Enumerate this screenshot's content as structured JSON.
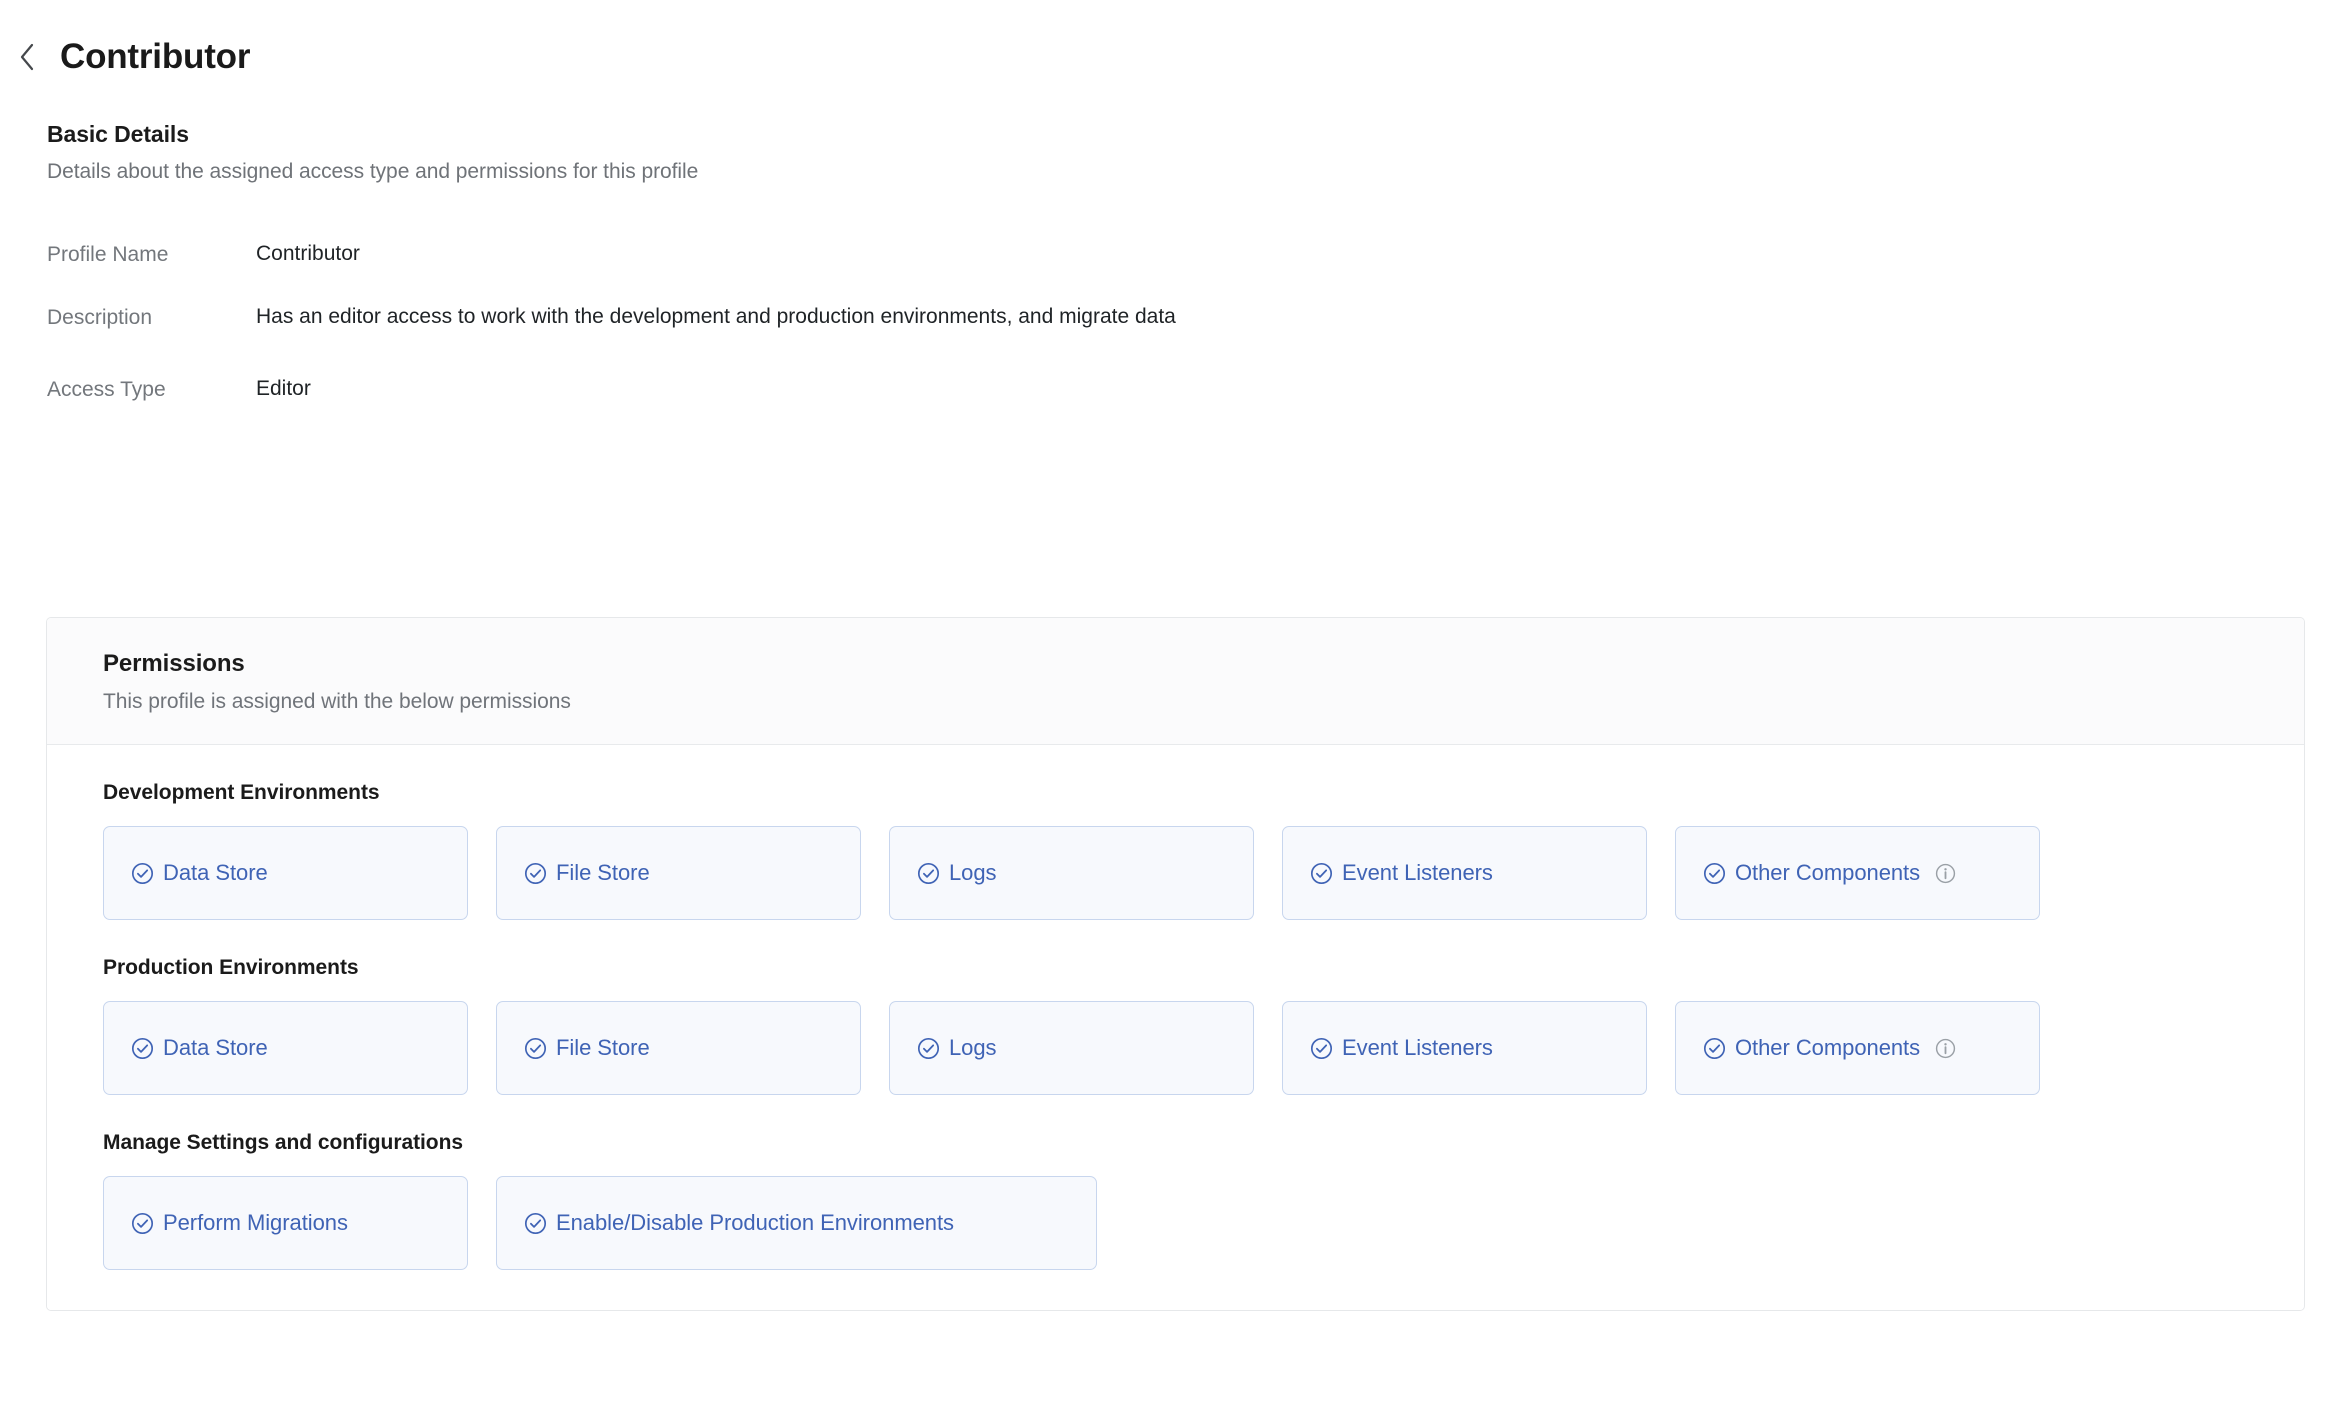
{
  "header": {
    "back_icon": "chevron-left-icon",
    "title": "Contributor"
  },
  "basic_details": {
    "title": "Basic Details",
    "subtitle": "Details about the assigned access type and permissions for this profile",
    "fields": [
      {
        "label": "Profile Name",
        "value": "Contributor"
      },
      {
        "label": "Description",
        "value": "Has an editor access to work with the development and production environments, and migrate data"
      },
      {
        "label": "Access Type",
        "value": "Editor"
      }
    ]
  },
  "permissions": {
    "title": "Permissions",
    "subtitle": "This profile is assigned with the below permissions",
    "groups": [
      {
        "title": "Development Environments",
        "chips": [
          {
            "label": "Data Store",
            "icon": "check-circle-icon",
            "info": false,
            "wide": false
          },
          {
            "label": "File Store",
            "icon": "check-circle-icon",
            "info": false,
            "wide": false
          },
          {
            "label": "Logs",
            "icon": "check-circle-icon",
            "info": false,
            "wide": false
          },
          {
            "label": "Event Listeners",
            "icon": "check-circle-icon",
            "info": false,
            "wide": false
          },
          {
            "label": "Other Components",
            "icon": "check-circle-icon",
            "info": true,
            "wide": false
          }
        ]
      },
      {
        "title": "Production Environments",
        "chips": [
          {
            "label": "Data Store",
            "icon": "check-circle-icon",
            "info": false,
            "wide": false
          },
          {
            "label": "File Store",
            "icon": "check-circle-icon",
            "info": false,
            "wide": false
          },
          {
            "label": "Logs",
            "icon": "check-circle-icon",
            "info": false,
            "wide": false
          },
          {
            "label": "Event Listeners",
            "icon": "check-circle-icon",
            "info": false,
            "wide": false
          },
          {
            "label": "Other Components",
            "icon": "check-circle-icon",
            "info": true,
            "wide": false
          }
        ]
      },
      {
        "title": "Manage Settings and configurations",
        "chips": [
          {
            "label": "Perform Migrations",
            "icon": "check-circle-icon",
            "info": false,
            "wide": false
          },
          {
            "label": "Enable/Disable Production Environments",
            "icon": "check-circle-icon",
            "info": false,
            "wide": true
          }
        ]
      }
    ]
  },
  "colors": {
    "chip_text": "#3f63b5",
    "chip_border": "#c8d6ee",
    "chip_background": "#f7f9fd",
    "label_text": "#73777c",
    "value_text": "#1f2326",
    "info_icon": "#9aa0a6"
  }
}
